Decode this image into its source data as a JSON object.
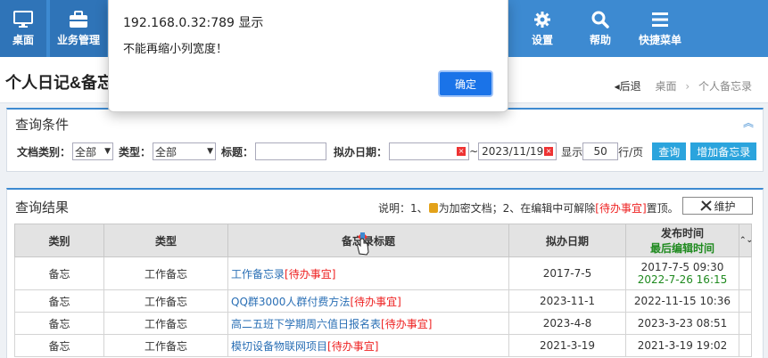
{
  "nav": {
    "desk": "桌面",
    "business": "业务管理",
    "settings": "设置",
    "help": "帮助",
    "quick_menu": "快捷菜单"
  },
  "page": {
    "title": "个人日记&备忘",
    "back": "◂后退",
    "breadcrumb": [
      "桌面",
      "个人备忘录"
    ]
  },
  "query": {
    "title": "查询条件",
    "collapse_icon": "double-chevron-up",
    "doc_type_label": "文档类别：",
    "doc_type_value": "全部",
    "type_label": "类型：",
    "type_value": "全部",
    "subject_label": "标题：",
    "subject_value": "",
    "date_label": "拟办日期：",
    "date_from": "",
    "date_tilde": "~",
    "date_to": "2023/11/19",
    "show_label": "显示",
    "page_size": "50",
    "per_page": "行/页",
    "query_button": "查询",
    "add_button": "增加备忘录"
  },
  "results": {
    "title": "查询结果",
    "note_prefix": "说明：1、",
    "note_lock": "为加密文档；2、在编辑中可解除",
    "note_red": "[待办事宜]",
    "note_suffix": "置顶。",
    "maintain_button": "维护",
    "columns": {
      "category": "类别",
      "type": "类型",
      "subject": "备忘录标题",
      "date": "拟办日期",
      "publish": "发布时间",
      "last_edit": "最后编辑时间"
    },
    "rows": [
      {
        "category": "备忘",
        "type": "工作备忘",
        "subject": "工作备忘录",
        "tag": "[待办事宜]",
        "date": "2017-7-5",
        "publish": "2017-7-5 09:30",
        "edited": "2022-7-26 16:15"
      },
      {
        "category": "备忘",
        "type": "工作备忘",
        "subject": "QQ群3000人群付费方法",
        "tag": "[待办事宜]",
        "date": "2023-11-1",
        "publish": "2022-11-15 10:36",
        "edited": ""
      },
      {
        "category": "备忘",
        "type": "工作备忘",
        "subject": "高二五班下学期周六值日报名表",
        "tag": "[待办事宜]",
        "date": "2023-4-8",
        "publish": "2023-3-23 08:51",
        "edited": ""
      },
      {
        "category": "备忘",
        "type": "工作备忘",
        "subject": "模切设备物联网项目",
        "tag": "[待办事宜]",
        "date": "2021-3-19",
        "publish": "2021-3-19 19:02",
        "edited": ""
      }
    ]
  },
  "dialog": {
    "title": "192.168.0.32:789 显示",
    "message": "不能再缩小列宽度！",
    "ok": "确定"
  },
  "colors": {
    "nav_bg": "#3d8ad1",
    "button": "#2ba4dd",
    "red_tag": "#e22222",
    "green_text": "#1f8a1f",
    "dialog_ok": "#1a73e8"
  }
}
